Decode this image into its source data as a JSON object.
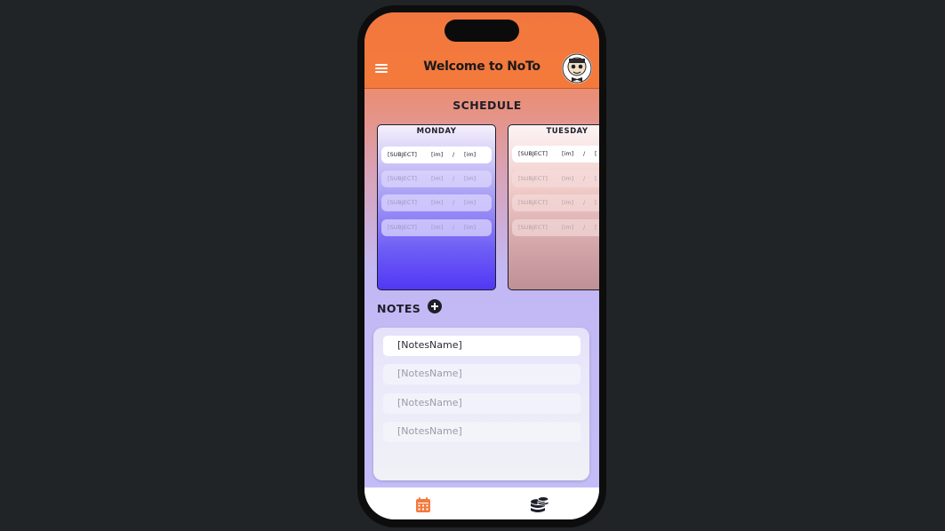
{
  "header": {
    "title": "Welcome to NoTo",
    "menu_icon": "menu-icon",
    "avatar_icon": "avatar-icon"
  },
  "schedule": {
    "title": "SCHEDULE",
    "days": [
      {
        "name": "MONDAY",
        "slots": [
          {
            "subject": "[SUBJECT]",
            "start": "[im]",
            "sep": "/",
            "end": "[im]"
          },
          {
            "subject": "[SUBJECT]",
            "start": "[im]",
            "sep": "/",
            "end": "[im]"
          },
          {
            "subject": "[SUBJECT]",
            "start": "[im]",
            "sep": "/",
            "end": "[im]"
          },
          {
            "subject": "[SUBJECT]",
            "start": "[im]",
            "sep": "/",
            "end": "[im]"
          }
        ]
      },
      {
        "name": "TUESDAY",
        "slots": [
          {
            "subject": "[SUBJECT]",
            "start": "[im]",
            "sep": "/",
            "end": "["
          },
          {
            "subject": "[SUBJECT]",
            "start": "[im]",
            "sep": "/",
            "end": "["
          },
          {
            "subject": "[SUBJECT]",
            "start": "[im]",
            "sep": "/",
            "end": "["
          },
          {
            "subject": "[SUBJECT]",
            "start": "[im]",
            "sep": "/",
            "end": "["
          }
        ]
      }
    ]
  },
  "notes": {
    "title": "NOTES",
    "add_icon": "plus-circle-icon",
    "items": [
      "[NotesName]",
      "[NotesName]",
      "[NotesName]",
      "[NotesName]"
    ]
  },
  "tabs": [
    {
      "icon": "calendar-icon",
      "active": true
    },
    {
      "icon": "database-icon",
      "active": false
    }
  ],
  "colors": {
    "accent": "#f47a3c",
    "ink": "#1e1e2a",
    "monday_bottom": "#5138f5"
  }
}
